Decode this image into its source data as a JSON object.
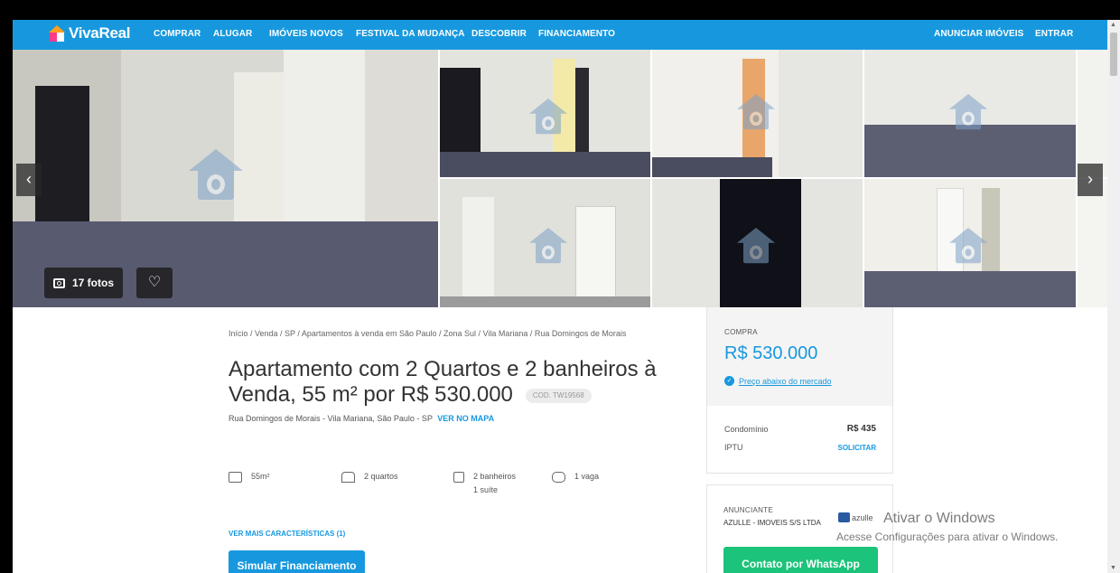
{
  "nav": {
    "logo": "VivaReal",
    "items": [
      "COMPRAR",
      "ALUGAR",
      "IMÓVEIS NOVOS",
      "FESTIVAL DA MUDANÇA",
      "DESCOBRIR",
      "FINANCIAMENTO"
    ],
    "right_items": [
      "ANUNCIAR IMÓVEIS",
      "ENTRAR"
    ]
  },
  "gallery": {
    "photo_count_label": "17 fotos",
    "prev_icon": "chevron-left-icon",
    "next_icon": "chevron-right-icon"
  },
  "listing": {
    "breadcrumb": "Início / Venda / SP / Apartamentos à venda em São Paulo / Zona Sul / Vila Mariana / Rua Domingos de Morais",
    "title": "Apartamento com 2 Quartos e 2 banheiros à Venda, 55 m² por R$ 530.000",
    "code": "COD. TW19568",
    "address": "Rua Domingos de Morais - Vila Mariana, São Paulo - SP",
    "map_link": "VER NO MAPA",
    "features": {
      "area": "55m²",
      "bedrooms": "2 quartos",
      "bathrooms": "2 banheiros",
      "suites": "1 suíte",
      "parking": "1 vaga"
    },
    "more_link": "VER MAIS CARACTERÍSTICAS (1)",
    "simulate_button": "Simular Financiamento"
  },
  "price": {
    "label": "COMPRA",
    "value": "R$ 530.000",
    "below_market": "Preço abaixo do mercado",
    "condo_label": "Condomínio",
    "condo_value": "R$ 435",
    "iptu_label": "IPTU",
    "iptu_link": "SOLICITAR"
  },
  "advertiser": {
    "label": "ANUNCIANTE",
    "name": "AZULLE - IMOVEIS S/S LTDA",
    "logo_text": "azulle",
    "whatsapp_button": "Contato por WhatsApp"
  },
  "windows": {
    "line1": "Ativar o Windows",
    "line2": "Acesse Configurações para ativar o Windows."
  },
  "colors": {
    "brand": "#1798de",
    "whatsapp": "#1cc37a"
  }
}
